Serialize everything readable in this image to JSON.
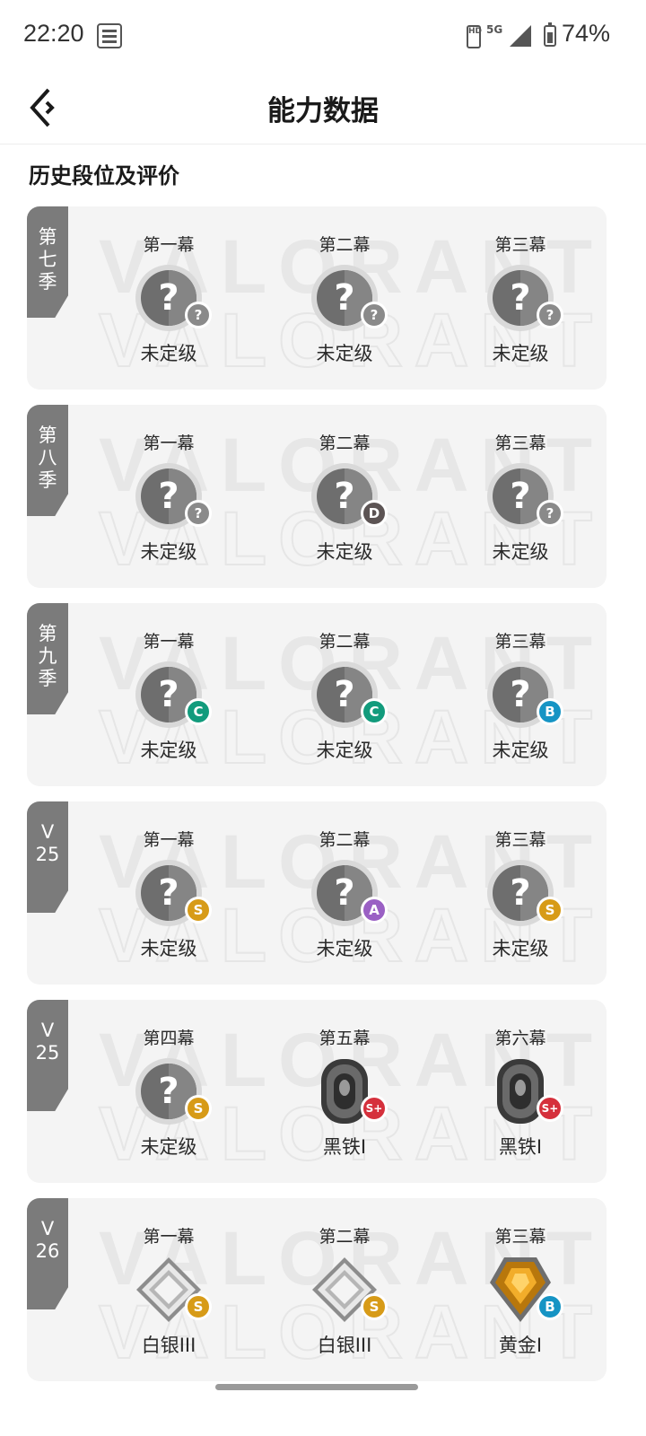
{
  "status_bar": {
    "time": "22:20",
    "network": "5G",
    "battery_pct": "74%"
  },
  "header": {
    "title": "能力数据"
  },
  "section": {
    "title": "历史段位及评价"
  },
  "watermark_text": "VALORANT",
  "colors": {
    "badge_unknown": "#8a8a8a",
    "badge_D": "#5c5454",
    "badge_C": "#129b7c",
    "badge_B": "#1694c4",
    "badge_A": "#9a60c4",
    "badge_S": "#d79b18",
    "badge_S_plus": "#d5303c"
  },
  "seasons": [
    {
      "label": "第\n七\n季",
      "acts": [
        {
          "act": "第一幕",
          "rank": "未定级",
          "icon": "unranked-icon",
          "grade": "?",
          "grade_color": "#8a8a8a"
        },
        {
          "act": "第二幕",
          "rank": "未定级",
          "icon": "unranked-icon",
          "grade": "?",
          "grade_color": "#8a8a8a"
        },
        {
          "act": "第三幕",
          "rank": "未定级",
          "icon": "unranked-icon",
          "grade": "?",
          "grade_color": "#8a8a8a"
        }
      ]
    },
    {
      "label": "第\n八\n季",
      "acts": [
        {
          "act": "第一幕",
          "rank": "未定级",
          "icon": "unranked-icon",
          "grade": "?",
          "grade_color": "#8a8a8a"
        },
        {
          "act": "第二幕",
          "rank": "未定级",
          "icon": "unranked-icon",
          "grade": "D",
          "grade_color": "#5c5454"
        },
        {
          "act": "第三幕",
          "rank": "未定级",
          "icon": "unranked-icon",
          "grade": "?",
          "grade_color": "#8a8a8a"
        }
      ]
    },
    {
      "label": "第\n九\n季",
      "acts": [
        {
          "act": "第一幕",
          "rank": "未定级",
          "icon": "unranked-icon",
          "grade": "C",
          "grade_color": "#129b7c"
        },
        {
          "act": "第二幕",
          "rank": "未定级",
          "icon": "unranked-icon",
          "grade": "C",
          "grade_color": "#129b7c"
        },
        {
          "act": "第三幕",
          "rank": "未定级",
          "icon": "unranked-icon",
          "grade": "B",
          "grade_color": "#1694c4"
        }
      ]
    },
    {
      "label": "V\n25",
      "acts": [
        {
          "act": "第一幕",
          "rank": "未定级",
          "icon": "unranked-icon",
          "grade": "S",
          "grade_color": "#d79b18"
        },
        {
          "act": "第二幕",
          "rank": "未定级",
          "icon": "unranked-icon",
          "grade": "A",
          "grade_color": "#9a60c4"
        },
        {
          "act": "第三幕",
          "rank": "未定级",
          "icon": "unranked-icon",
          "grade": "S",
          "grade_color": "#d79b18"
        }
      ]
    },
    {
      "label": "V\n25",
      "acts": [
        {
          "act": "第四幕",
          "rank": "未定级",
          "icon": "unranked-icon",
          "grade": "S",
          "grade_color": "#d79b18"
        },
        {
          "act": "第五幕",
          "rank": "黑铁I",
          "icon": "iron-rank-icon",
          "grade": "S+",
          "grade_color": "#d5303c"
        },
        {
          "act": "第六幕",
          "rank": "黑铁I",
          "icon": "iron-rank-icon",
          "grade": "S+",
          "grade_color": "#d5303c"
        }
      ]
    },
    {
      "label": "V\n26",
      "acts": [
        {
          "act": "第一幕",
          "rank": "白银III",
          "icon": "silver-rank-icon",
          "grade": "S",
          "grade_color": "#d79b18"
        },
        {
          "act": "第二幕",
          "rank": "白银III",
          "icon": "silver-rank-icon",
          "grade": "S",
          "grade_color": "#d79b18"
        },
        {
          "act": "第三幕",
          "rank": "黄金I",
          "icon": "gold-rank-icon",
          "grade": "B",
          "grade_color": "#1694c4"
        }
      ]
    }
  ]
}
